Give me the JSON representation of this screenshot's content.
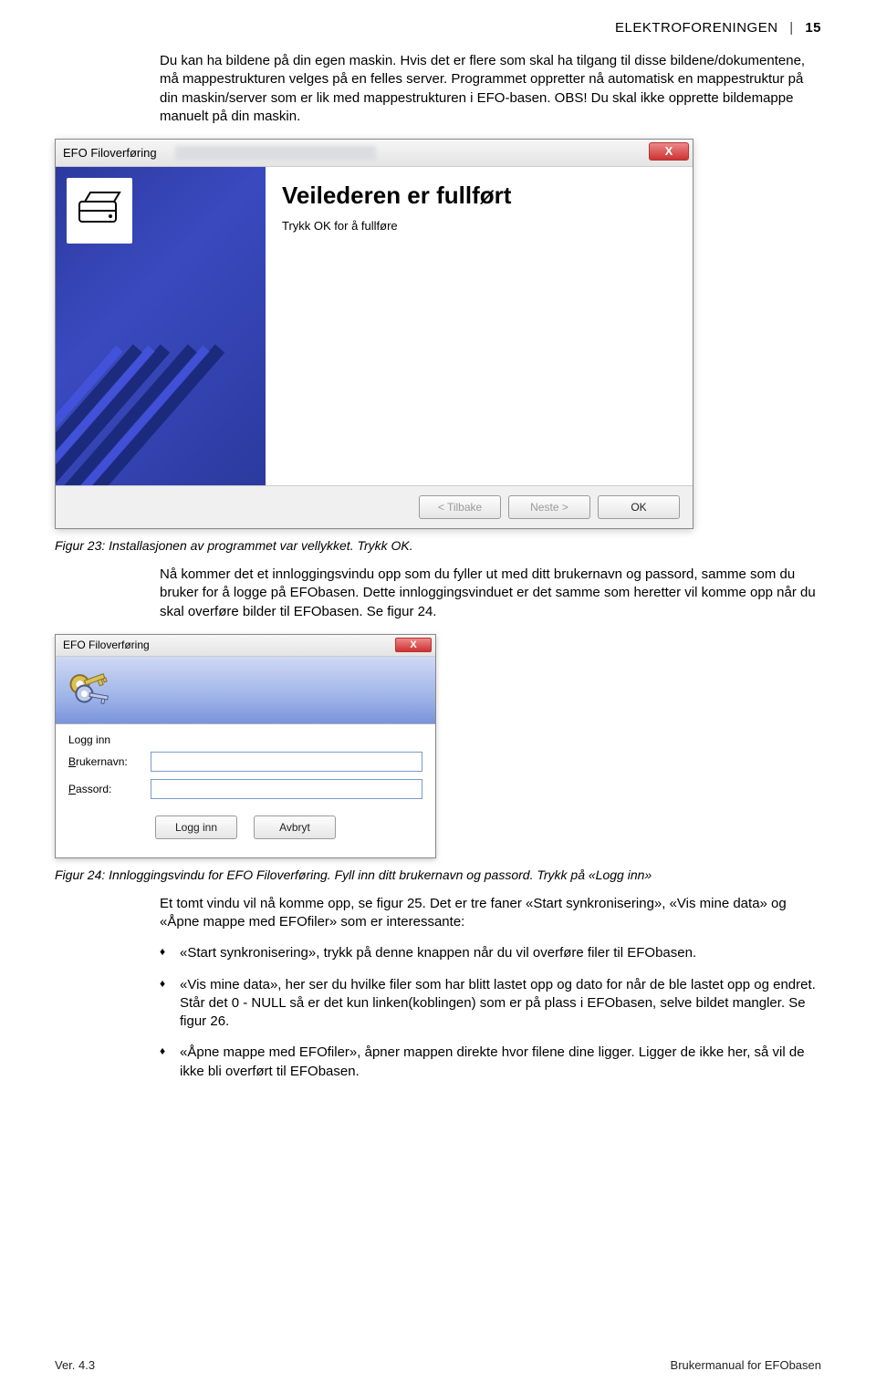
{
  "header": {
    "org": "ELEKTROFORENINGEN",
    "page": "15"
  },
  "intro": "Du kan ha bildene på din egen maskin. Hvis det er flere som skal ha tilgang til disse bildene/dokumentene, må mappestrukturen velges på en felles server. Programmet oppretter nå automatisk en mappestruktur på din maskin/server som er lik med mappestrukturen i EFO-basen. OBS! Du skal ikke opprette bildemappe manuelt på din maskin.",
  "dialog1": {
    "title": "EFO Filoverføring",
    "close": "X",
    "heading": "Veilederen er fullført",
    "sub": "Trykk OK for å fullføre",
    "btn_back": "< Tilbake",
    "btn_next": "Neste >",
    "btn_ok": "OK"
  },
  "caption1": "Figur 23: Installasjonen av programmet var vellykket. Trykk OK.",
  "para2": "Nå kommer det et innloggingsvindu opp som du fyller ut med ditt brukernavn og passord, samme som du bruker for å logge på EFObasen. Dette innloggingsvinduet er det samme som heretter vil komme opp når du skal overføre bilder til EFObasen. Se figur 24.",
  "dialog2": {
    "title": "EFO Filoverføring",
    "close": "X",
    "label": "Logg inn",
    "user_label_pre": "B",
    "user_label_rest": "rukernavn:",
    "pass_label_pre": "P",
    "pass_label_rest": "assord:",
    "user_value": "",
    "pass_value": "",
    "btn_login": "Logg inn",
    "btn_cancel": "Avbryt"
  },
  "caption2": "Figur 24: Innloggingsvindu for EFO Filoverføring. Fyll inn ditt brukernavn og passord. Trykk på «Logg inn»",
  "para3": "Et tomt vindu vil nå komme opp, se figur 25. Det er tre faner «Start synkronisering», «Vis mine data» og «Åpne mappe med EFOfiler» som er interessante:",
  "bullets": [
    "«Start synkronisering», trykk på denne knappen når du vil overføre filer til EFObasen.",
    "«Vis mine data», her ser du hvilke filer som har blitt lastet opp og dato for når de ble lastet opp og endret. Står det 0 - NULL så er det kun linken(koblingen) som er på plass i EFObasen, selve bildet mangler. Se figur 26.",
    "«Åpne mappe med EFOfiler», åpner mappen direkte hvor filene dine ligger. Ligger de ikke her, så vil de ikke bli overført til EFObasen."
  ],
  "footer": {
    "left": "Ver. 4.3",
    "right": "Brukermanual for EFObasen"
  }
}
